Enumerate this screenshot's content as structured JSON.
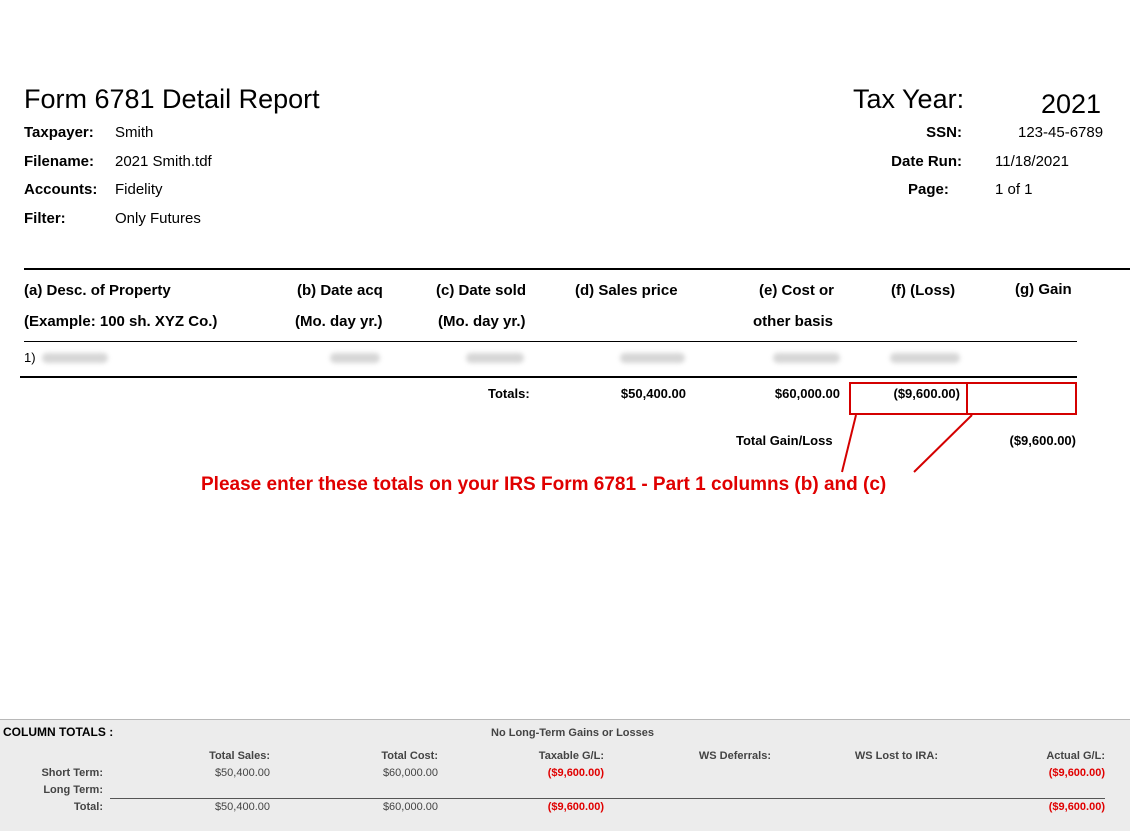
{
  "header": {
    "title": "Form 6781 Detail Report",
    "tax_year_label": "Tax Year:",
    "tax_year": "2021",
    "fields_left": [
      {
        "label": "Taxpayer:",
        "value": "Smith"
      },
      {
        "label": "Filename:",
        "value": "2021 Smith.tdf"
      },
      {
        "label": "Accounts:",
        "value": "Fidelity"
      },
      {
        "label": "Filter:",
        "value": "Only Futures"
      }
    ],
    "fields_right": [
      {
        "label": "SSN:",
        "value": "123-45-6789"
      },
      {
        "label": "Date Run:",
        "value": "11/18/2021"
      },
      {
        "label": "Page:",
        "value": "1 of 1"
      }
    ]
  },
  "table": {
    "columns": [
      {
        "line1": "(a) Desc. of Property",
        "line2": "(Example: 100 sh. XYZ Co.)"
      },
      {
        "line1": "(b) Date acq",
        "line2": "(Mo. day yr.)"
      },
      {
        "line1": "(c) Date sold",
        "line2": "(Mo. day yr.)"
      },
      {
        "line1": "(d) Sales price",
        "line2": ""
      },
      {
        "line1": "(e) Cost or",
        "line2": "other basis"
      },
      {
        "line1": "(f) (Loss)",
        "line2": ""
      },
      {
        "line1": "(g) Gain",
        "line2": ""
      }
    ],
    "row_number": "1)",
    "totals_label": "Totals:",
    "totals_sales": "$50,400.00",
    "totals_cost": "$60,000.00",
    "totals_loss": "($9,600.00)",
    "totals_gain": "",
    "gain_loss_label": "Total Gain/Loss",
    "gain_loss_value": "($9,600.00)"
  },
  "annotation": "Please enter these totals on your IRS Form 6781 - Part 1 columns (b) and (c)",
  "column_totals": {
    "label": "COLUMN TOTALS :",
    "long_term_note": "No Long-Term Gains or Losses",
    "headers": [
      "Total Sales:",
      "Total Cost:",
      "Taxable G/L:",
      "WS Deferrals:",
      "WS Lost to IRA:",
      "Actual G/L:"
    ],
    "rows": [
      {
        "label": "Short Term:",
        "sales": "$50,400.00",
        "cost": "$60,000.00",
        "taxable": "($9,600.00)",
        "actual": "($9,600.00)"
      },
      {
        "label": "Long Term:",
        "sales": "",
        "cost": "",
        "taxable": "",
        "actual": ""
      },
      {
        "label": "Total:",
        "sales": "$50,400.00",
        "cost": "$60,000.00",
        "taxable": "($9,600.00)",
        "actual": "($9,600.00)"
      }
    ]
  },
  "colors": {
    "accent_red": "#e00000"
  }
}
